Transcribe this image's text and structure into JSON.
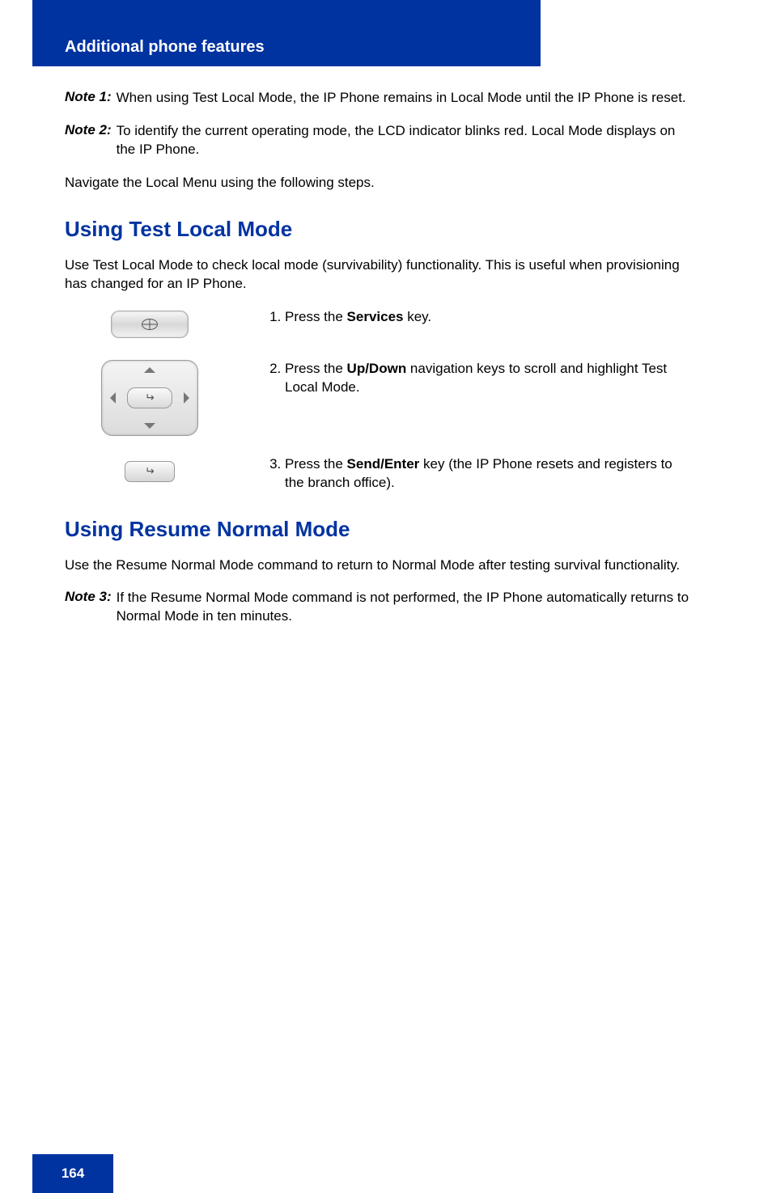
{
  "header": {
    "title": "Additional phone features"
  },
  "note1": {
    "label": "Note 1:",
    "text": "When using Test Local Mode, the IP Phone remains in Local Mode until the IP Phone is reset."
  },
  "note2": {
    "label": "Note 2:",
    "text": "To identify the current operating mode, the LCD indicator blinks red. Local Mode displays on the IP Phone."
  },
  "intro_after_notes": "Navigate the Local Menu using the following steps.",
  "section1": {
    "heading": "Using Test Local Mode",
    "intro": "Use Test Local Mode to check local mode (survivability) functionality. This is useful when provisioning has changed for an IP Phone.",
    "step1a": "Press the ",
    "step1_key": "Services",
    "step1b": " key.",
    "step2a": "Press the ",
    "step2_key": "Up/Down",
    "step2b": " navigation keys to scroll and highlight Test Local Mode.",
    "step3a": "Press the ",
    "step3_key": "Send/Enter",
    "step3b": " key (the IP Phone resets and registers to the branch office)."
  },
  "section2": {
    "heading": "Using Resume Normal Mode",
    "intro": "Use the Resume Normal Mode command to return to Normal Mode after testing survival functionality.",
    "note3_label": "Note 3:",
    "note3_text": "If the Resume Normal Mode command is not performed, the IP Phone automatically returns to Normal Mode in ten minutes."
  },
  "footer": {
    "page": "164"
  }
}
